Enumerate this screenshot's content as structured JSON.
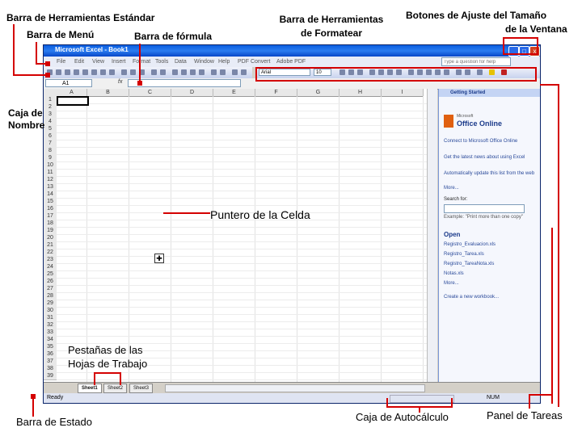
{
  "labels": {
    "standard_toolbar": "Barra de Herramientas Estándar",
    "menu_bar": "Barra de Menú",
    "formula_bar": "Barra de fórmula",
    "format_toolbar_line1": "Barra de Herramientas",
    "format_toolbar_line2": "de Formatear",
    "size_buttons_line1": "Botones de Ajuste del Tamaño",
    "size_buttons_line2": "de la Ventana",
    "name_box_line1": "Caja de",
    "name_box_line2": "Nombre",
    "cell_pointer": "Puntero de la Celda",
    "sheet_tabs_line1": "Pestañas de las",
    "sheet_tabs_line2": "Hojas de Trabajo",
    "status_bar": "Barra de Estado",
    "autocalc_box": "Caja de Autocálculo",
    "task_pane": "Panel de Tareas"
  },
  "window": {
    "title": "Microsoft Excel - Book1",
    "help_placeholder": "Type a question for help",
    "min_glyph": "_",
    "max_glyph": "□",
    "close_glyph": "x"
  },
  "menus": [
    "File",
    "Edit",
    "View",
    "Insert",
    "Format",
    "Tools",
    "Data",
    "Window",
    "Help",
    "PDF Convert",
    "Adobe PDF"
  ],
  "format_toolbar": {
    "font": "Arial",
    "size": "10"
  },
  "formula_bar": {
    "cell_ref": "A1",
    "fx": "fx"
  },
  "columns": [
    "A",
    "B",
    "C",
    "D",
    "E",
    "F",
    "G",
    "H",
    "I"
  ],
  "rows": [
    "1",
    "2",
    "3",
    "4",
    "5",
    "6",
    "7",
    "8",
    "9",
    "10",
    "11",
    "12",
    "13",
    "14",
    "15",
    "16",
    "17",
    "18",
    "19",
    "20",
    "21",
    "22",
    "23",
    "24",
    "25",
    "26",
    "27",
    "28",
    "29",
    "30",
    "31",
    "32",
    "33",
    "34",
    "35",
    "36",
    "37",
    "38",
    "39"
  ],
  "task_pane": {
    "title": "Getting Started",
    "brand_small": "Microsoft",
    "brand": "Office Online",
    "bullets": [
      "Connect to Microsoft Office Online",
      "Get the latest news about using Excel",
      "Automatically update this list from the web"
    ],
    "more": "More...",
    "search_label": "Search for:",
    "example": "Example: \"Print more than one copy\"",
    "open_heading": "Open",
    "files": [
      "Registro_Evaluacion.xls",
      "Registro_Tarea.xls",
      "Registro_TareaNota.xls",
      "Notas.xls",
      "More..."
    ],
    "create_new": "Create a new workbook..."
  },
  "sheet_tabs": [
    "Sheet1",
    "Sheet2",
    "Sheet3"
  ],
  "status": {
    "left": "Ready",
    "right": "NUM"
  }
}
